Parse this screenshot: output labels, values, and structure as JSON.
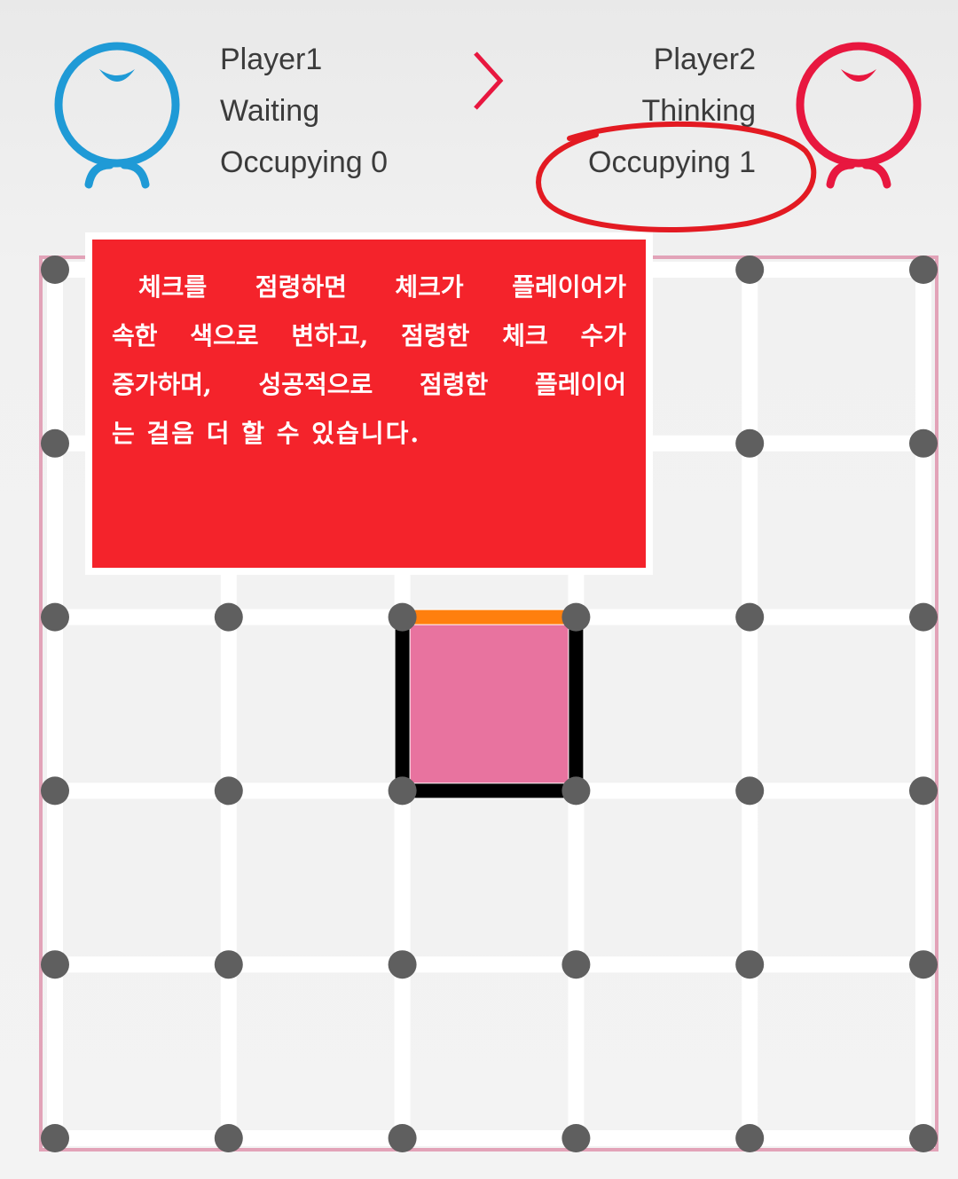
{
  "header": {
    "player1": {
      "name": "Player1",
      "status": "Waiting",
      "occupying": "Occupying 0",
      "color": "#1f9ad6"
    },
    "player2": {
      "name": "Player2",
      "status": "Thinking",
      "occupying": "Occupying 1",
      "color": "#e8173f"
    },
    "turn_arrow_icon": "chevron-right-icon",
    "turn_arrow_color": "#e8173f"
  },
  "board": {
    "dots_per_side": 6,
    "claimed_box": {
      "row": 2,
      "col": 2,
      "fill_color": "#e8739f",
      "owner": "Player2"
    },
    "drawn_edges": [
      {
        "type": "h",
        "row": 2,
        "col": 2,
        "color": "#ff7f0e"
      },
      {
        "type": "h",
        "row": 3,
        "col": 2,
        "color": "#000000"
      },
      {
        "type": "v",
        "row": 2,
        "col": 2,
        "color": "#000000"
      },
      {
        "type": "v",
        "row": 2,
        "col": 3,
        "color": "#000000"
      }
    ],
    "dot_color": "#5f5f5f",
    "line_color": "#ffffff",
    "frame_color": "#e2a3b8"
  },
  "note": {
    "lines": [
      "체크를 점령하면 체크가 플레이어가",
      "속한 색으로 변하고, 점령한 체크 수가",
      "증가하며, 성공적으로 점령한 플레이어",
      "는 걸음 더 할 수 있습니다."
    ],
    "background": "#f4232b"
  }
}
